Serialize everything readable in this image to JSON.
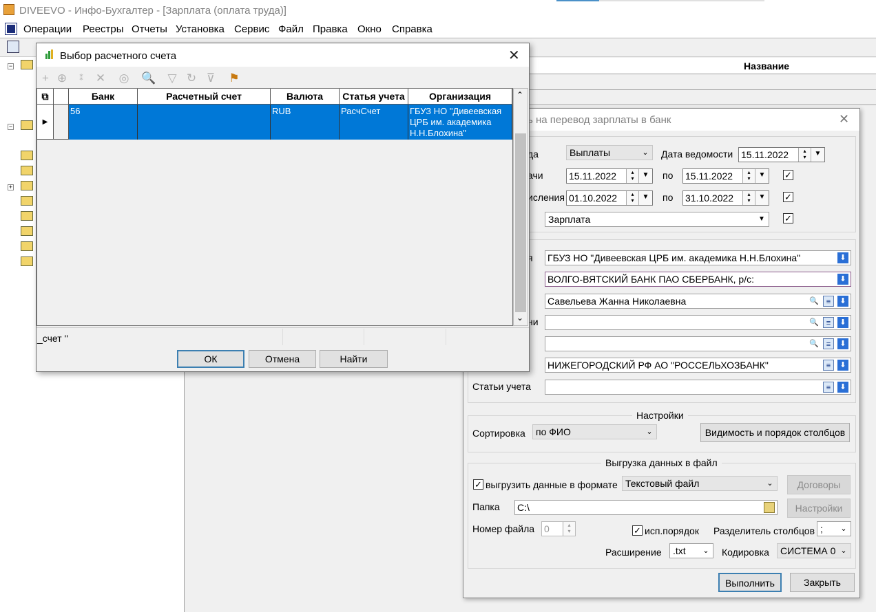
{
  "app": {
    "title": "DIVEEVO - Инфо-Бухгалтер - [Зарплата (оплата труда)]",
    "menu": [
      "Операции",
      "Реестры",
      "Отчеты",
      "Установка",
      "Сервис",
      "Файл",
      "Правка",
      "Окно",
      "Справка"
    ]
  },
  "grid_header": {
    "name_col": "Название"
  },
  "settings_dialog": {
    "title": "ь на перевод зарплаты в банк",
    "row1": {
      "label": "да",
      "type_value": "Выплаты",
      "date_label": "Дата ведомости",
      "date_value": "15.11.2022"
    },
    "row2": {
      "label": "ачи",
      "from": "15.11.2022",
      "to_label": "по",
      "to": "15.11.2022",
      "checked": true
    },
    "row3": {
      "label": "исления",
      "from": "01.10.2022",
      "to_label": "по",
      "to": "31.10.2022",
      "checked": true
    },
    "row4": {
      "value": "Зарплата",
      "checked": true
    },
    "org_label": "я",
    "org_value": "ГБУЗ НО \"Дивеевская ЦРБ им. академика Н.Н.Блохина\"",
    "bank_value": "ВОЛГО-ВЯТСКИЙ БАНК ПАО СБЕРБАНК, р/с:",
    "person_value": "Савельева Жанна Николаевна",
    "row_ni_label": "ни",
    "row_ni_value": "",
    "row_blank_value": "",
    "bank2_value": "НИЖЕГОРОДСКИЙ РФ АО \"РОССЕЛЬХОЗБАНК\"",
    "articles_label": "Статьи учета",
    "articles_value": "",
    "settings_group": "Настройки",
    "sort_label": "Сортировка",
    "sort_value": "по ФИО",
    "columns_button": "Видимость и порядок столбцов",
    "export_group": "Выгрузка данных в файл",
    "export_check_label": "выгрузить данные в формате",
    "export_checked": true,
    "export_format": "Текстовый файл",
    "contracts_button": "Договоры",
    "folder_label": "Папка",
    "folder_value": "C:\\",
    "settings_button": "Настройки",
    "file_no_label": "Номер файла",
    "file_no_value": "0",
    "order_check_label": "исп.порядок",
    "order_checked": true,
    "sep_label": "Разделитель столбцов",
    "sep_value": ";",
    "ext_label": "Расширение",
    "ext_value": ".txt",
    "enc_label": "Кодировка",
    "enc_value": "СИСТЕМА 0",
    "run_button": "Выполнить",
    "close_button": "Закрыть"
  },
  "account_dialog": {
    "title": "Выбор расчетного счета",
    "columns": [
      "Банк",
      "Расчетный счет",
      "Валюта",
      "Статья учета",
      "Организация"
    ],
    "row": {
      "bank": "56",
      "account": "",
      "currency": "RUB",
      "article": "РасчСчет",
      "org": "ГБУЗ НО \"Дивеевская ЦРБ им. академика Н.Н.Блохина\""
    },
    "status": "_счет ''",
    "ok": "ОК",
    "cancel": "Отмена",
    "find": "Найти"
  },
  "colors": {
    "selection": "#0078d7",
    "accent": "#3c7fb1"
  }
}
